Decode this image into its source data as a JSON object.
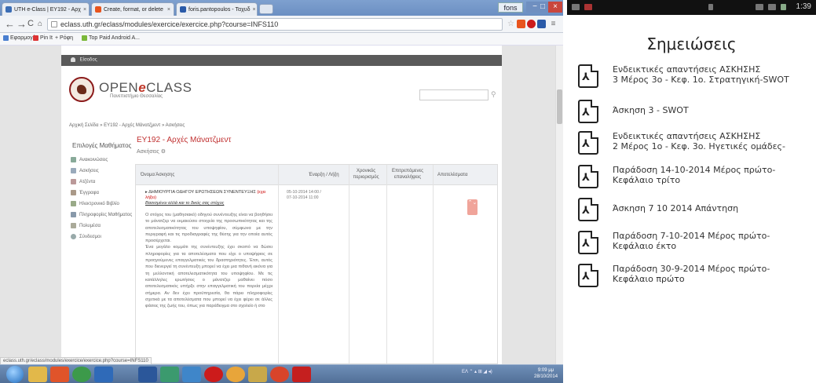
{
  "browser": {
    "tabs": [
      {
        "label": "UTH e-Class | ΕΥ192 - Αρχ",
        "favicon_color": "#3b6db5"
      },
      {
        "label": "Create, format, or delete",
        "favicon_color": "#e8541d"
      },
      {
        "label": "foris.pantopoulos - Ταχυδ",
        "favicon_color": "#2a5aa8"
      }
    ],
    "user_badge": "fons",
    "window_controls": [
      "−",
      "□",
      "×"
    ],
    "url": "eclass.uth.gr/eclass/modules/exercice/exercice.php?course=INFS110",
    "status_url": "eclass.uth.gr/eclass/modules/exercice/exercice.php?course=INFS110",
    "bookmarks": [
      {
        "label": "Εφαρμογές",
        "color": "#4a7fd0"
      },
      {
        "label": "Pin It",
        "color": "#d33"
      },
      {
        "label": "+ Pόφη",
        "color": "#d04a20"
      },
      {
        "label": "Top Paid Android A...",
        "color": "#7bb83a"
      }
    ]
  },
  "eclass": {
    "login_label": "Είσοδος",
    "brand_left": "OPEN",
    "brand_e": "e",
    "brand_right": "CLASS",
    "university": "Πανεπιστήμιο Θεσσαλίας",
    "breadcrumb": "Αρχική Σελίδα » ΕΥ192 - Αρχές Μάνατζμεντ » Ασκήσεις",
    "sidebar_title": "Επιλογές Μαθήματος",
    "sidebar_items": [
      {
        "label": "Ανακοινώσεις",
        "color": "#8a9"
      },
      {
        "label": "Ασκήσεις",
        "color": "#9ab"
      },
      {
        "label": "Ατζέντα",
        "color": "#b99"
      },
      {
        "label": "Έγγραφα",
        "color": "#a98"
      },
      {
        "label": "Ηλεκτρονικό Βιβλίο",
        "color": "#9a8"
      },
      {
        "label": "Πληροφορίες Μαθήματος",
        "color": "#89a"
      },
      {
        "label": "Πολυμέσα",
        "color": "#aa9"
      },
      {
        "label": "Σύνδεσμοι",
        "color": "#9aa"
      }
    ],
    "course_title": "ΕΥ192 - Αρχές Μάνατζμεντ",
    "subtitle": "Ασκήσεις",
    "table_headers": {
      "name": "Όνομα Άσκησης",
      "dates": "Έναρξη / Λήξη",
      "time_limit": "Χρονικός περιορισμός",
      "attempts": "Επιτρεπόμενες επαναλήψεις",
      "results": "Αποτελέσματα"
    },
    "exercise": {
      "title": "ΔΗΜΙΟΥΡΓΙΑ ΟΔΗΓΟΥ ΕΡΩΤΗΣΕΩΝ ΣΥΝΕΝΤΕΥΞΗΣ",
      "tag": "(εχει λήξει)",
      "subtitle": "Βασισμένοι αλλά και το δικός σας στόχος",
      "body": [
        "Ο στόχος του (μαθησιακό) οδηγού συνέντευξης είναι να βοηθήσει το μάνατζερ να εκμαιεύσει στοιχεία της προσωπικότητας και της αποτελεσματικότητας του υποψηφίου, σύμφωνα με την περιγραφή και τις προδιαγραφές της θέσης για την οποία αυτός προσέρχεται.",
        "Ένα μεγάλο κομμάτι της συνέντευξης έχει σκοπό να δώσει πληροφορίες για τα αποτελέσματα που είχε ο υποψήφιος σε προηγούμενες επαγγελματικές του δραστηριότητες. Έτσι, αυτός που διενεργεί τη συνέντευξη μπορεί να έχει μια πιθανή εικόνα για τη μελλοντική αποτελεσματικότητα του υποψηφίου. Με τις κατάλληλες ερωτήσεις ο μάνατζερ μαθαίνει πόσο αποτελεσματικός υπήρξε στην επαγγελματική του πορεία μέχρι σήμερα. Αν δεν έχει προϋπηρεσία, θα πάρει πληροφορίες σχετικά με τα αποτελέσματα που μπορεί να έχει φέρει σε άλλες φάσεις της ζωής του, όπως για παράδειγμα στο σχολείο ή στο"
      ],
      "dates": "05-10-2014 14:00 / 07-10-2014 11:00"
    },
    "side_badge": "⌃⌄"
  },
  "taskbar": {
    "apps": [
      {
        "name": "explorer",
        "color": "#e2b84a"
      },
      {
        "name": "office",
        "color": "#e0542a"
      },
      {
        "name": "chrome",
        "color": "#3c9a4a"
      },
      {
        "name": "outlook",
        "color": "#2f6ab8"
      },
      {
        "name": "word",
        "color": "#2b579a"
      },
      {
        "name": "publisher",
        "color": "#3b9a6e"
      },
      {
        "name": "users",
        "color": "#3f86c9"
      },
      {
        "name": "opera",
        "color": "#cc1b1b"
      },
      {
        "name": "chrome2",
        "color": "#e8a53a"
      },
      {
        "name": "paint",
        "color": "#c8a84a"
      },
      {
        "name": "media",
        "color": "#d8442a"
      },
      {
        "name": "acrobat",
        "color": "#c51f1f"
      }
    ],
    "tray_lang": "ΕΛ",
    "clock_time": "9:09 μμ",
    "clock_date": "28/10/2014"
  },
  "phone": {
    "status_time": "1:39",
    "title": "Σημειώσεις",
    "pdf_glyph": "⅄",
    "notes": [
      {
        "line1": "Ενδεικτικές απαντήσεις ΑΣΚΗΣΗΣ",
        "line2": "3 Μέρος 3ο - Κεφ. 1ο. Στρατηγική-SWOT"
      },
      {
        "line1": "Άσκηση 3 - SWOT",
        "line2": ""
      },
      {
        "line1": "Ενδεικτικές απαντήσεις ΑΣΚΗΣΗΣ",
        "line2": "2 Μέρος 1ο - Κεφ. 3ο. Ηγετικές ομάδες-"
      },
      {
        "line1": "Παράδοση 14-10-2014 Μέρος πρώτο-",
        "line2": "Κεφάλαιο τρίτο"
      },
      {
        "line1": "Άσκηση 7 10 2014 Απάντηση",
        "line2": ""
      },
      {
        "line1": "Παράδοση 7-10-2014 Μέρος πρώτο-",
        "line2": "Κεφάλαιο έκτο"
      },
      {
        "line1": "Παράδοση 30-9-2014 Μέρος πρώτο-",
        "line2": "Κεφάλαιο πρώτο"
      }
    ]
  }
}
